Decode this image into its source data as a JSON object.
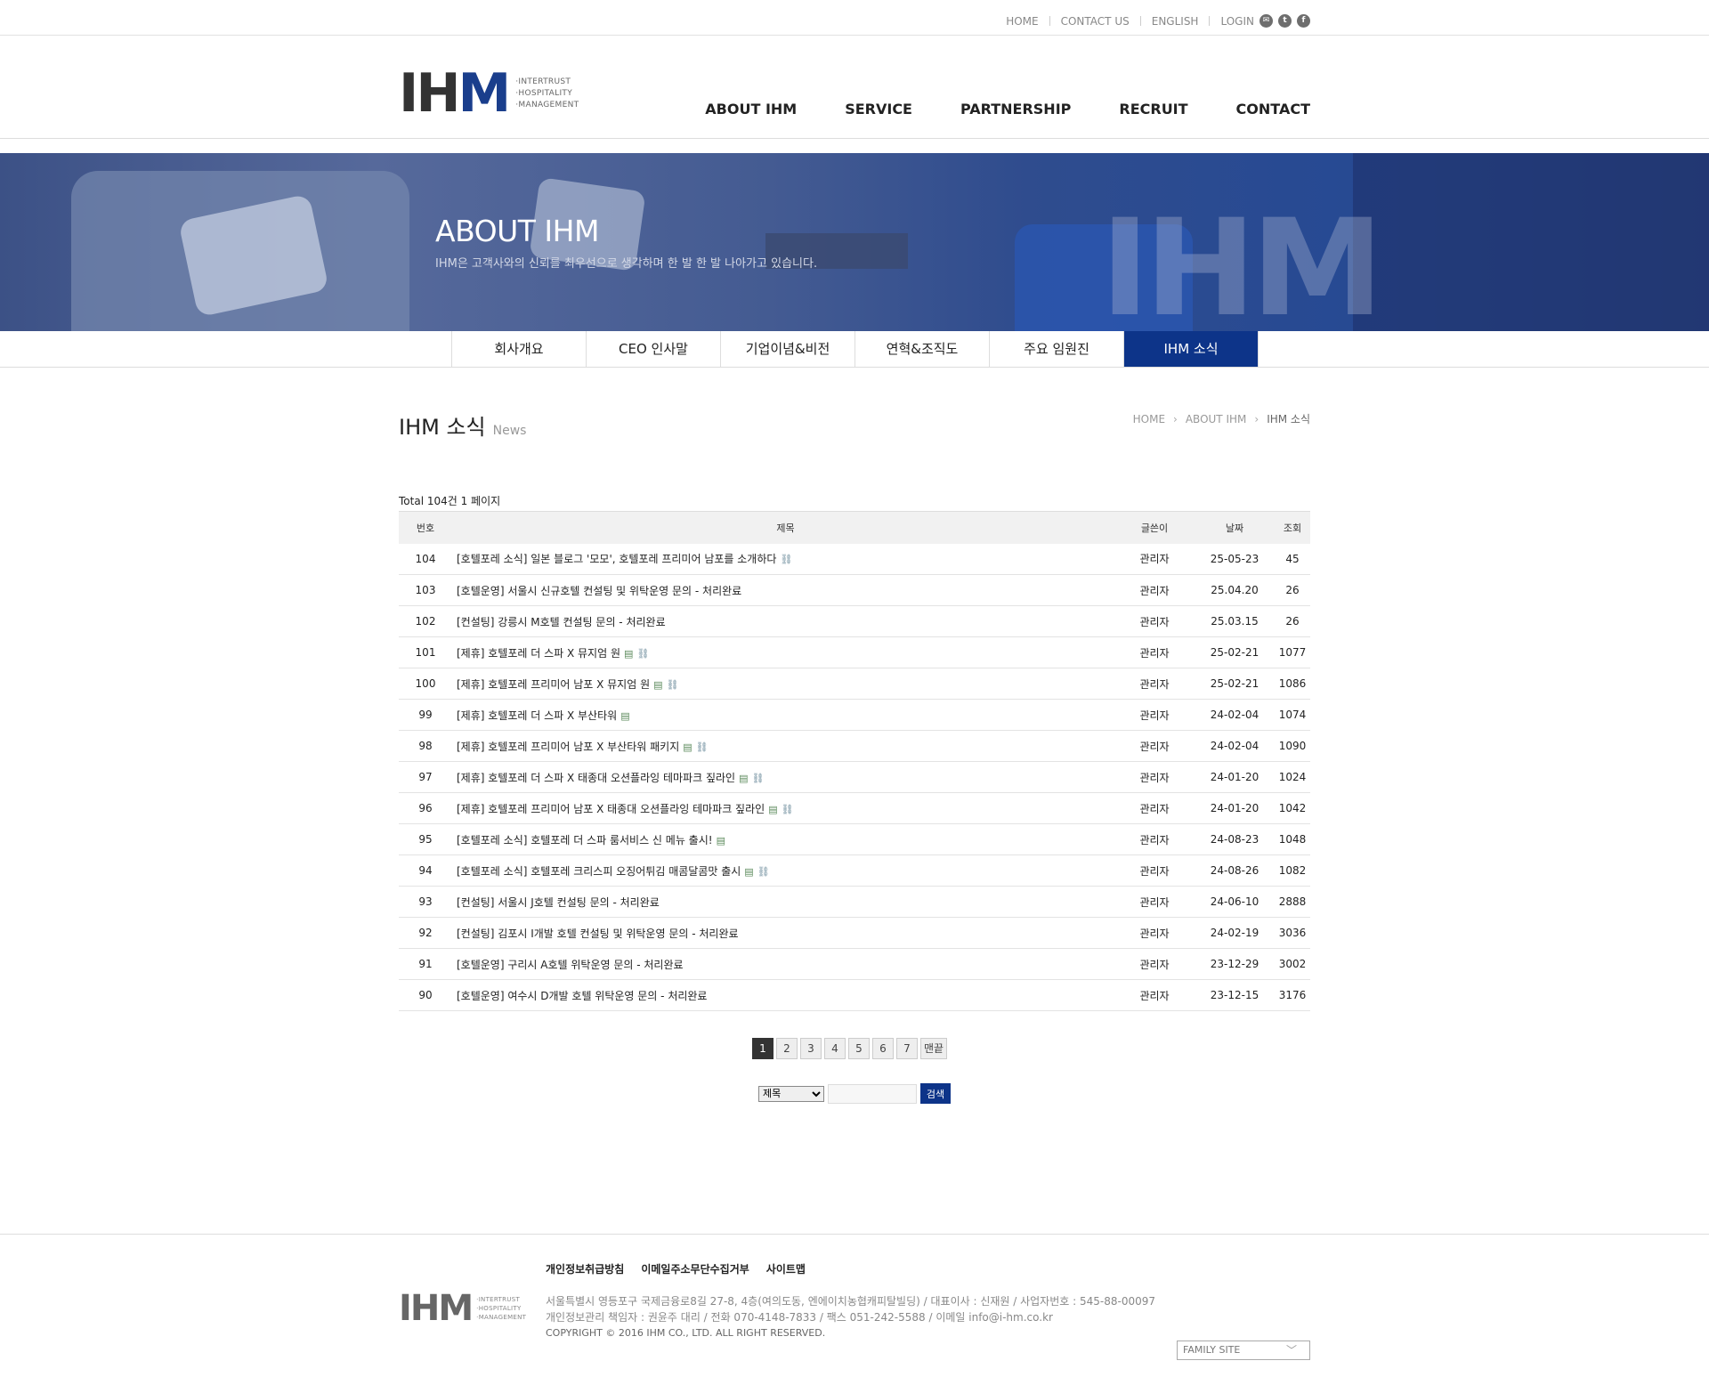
{
  "util_nav": {
    "home": "HOME",
    "contact_us": "CONTACT US",
    "english": "ENGLISH",
    "login": "LOGIN",
    "icons": [
      "mail-icon",
      "twitter-icon",
      "facebook-icon"
    ]
  },
  "logo": {
    "mark_ih": "IH",
    "mark_m": "M",
    "sub1": "·INTERTRUST",
    "sub2": "·HOSPITALITY",
    "sub3": "·MANAGEMENT"
  },
  "gnb": [
    "ABOUT IHM",
    "SERVICE",
    "PARTNERSHIP",
    "RECRUIT",
    "CONTACT"
  ],
  "hero": {
    "title": "ABOUT IHM",
    "subtitle": "IHM은 고객사와의 신뢰를 최우선으로 생각하며 한 발 한 발 나아가고 있습니다.",
    "watermark": "IHM"
  },
  "subnav": [
    "회사개요",
    "CEO 인사말",
    "기업이념&비전",
    "연혁&조직도",
    "주요 임원진",
    "IHM 소식"
  ],
  "page": {
    "title": "IHM 소식",
    "title_en": "News",
    "breadcrumb": [
      "HOME",
      "ABOUT IHM",
      "IHM 소식"
    ],
    "total": "Total 104건 1 페이지"
  },
  "board": {
    "headers": [
      "번호",
      "제목",
      "글쓴이",
      "날짜",
      "조회"
    ],
    "rows": [
      {
        "no": "104",
        "title": "[호텔포레 소식] 일본 블로그 '모모', 호텔포레 프리미어 남포를 소개하다",
        "file": false,
        "link": true,
        "writer": "관리자",
        "date": "25-05-23",
        "hit": "45"
      },
      {
        "no": "103",
        "title": "[호텔운영] 서울시 신규호텔 컨설팅 및 위탁운영 문의 - 처리완료",
        "file": false,
        "link": false,
        "writer": "관리자",
        "date": "25.04.20",
        "hit": "26"
      },
      {
        "no": "102",
        "title": "[컨설팅] 강릉시 M호텔 컨설팅 문의 - 처리완료",
        "file": false,
        "link": false,
        "writer": "관리자",
        "date": "25.03.15",
        "hit": "26"
      },
      {
        "no": "101",
        "title": "[제휴] 호텔포레 더 스파 X 뮤지엄 원",
        "file": true,
        "link": true,
        "writer": "관리자",
        "date": "25-02-21",
        "hit": "1077"
      },
      {
        "no": "100",
        "title": "[제휴] 호텔포레 프리미어 남포 X 뮤지엄 원",
        "file": true,
        "link": true,
        "writer": "관리자",
        "date": "25-02-21",
        "hit": "1086"
      },
      {
        "no": "99",
        "title": "[제휴] 호텔포레 더 스파 X 부산타워",
        "file": true,
        "link": false,
        "writer": "관리자",
        "date": "24-02-04",
        "hit": "1074"
      },
      {
        "no": "98",
        "title": "[제휴] 호텔포레 프리미어 남포 X 부산타워 패키지",
        "file": true,
        "link": true,
        "writer": "관리자",
        "date": "24-02-04",
        "hit": "1090"
      },
      {
        "no": "97",
        "title": "[제휴] 호텔포레 더 스파 X 태종대 오션플라잉 테마파크 짚라인",
        "file": true,
        "link": true,
        "writer": "관리자",
        "date": "24-01-20",
        "hit": "1024"
      },
      {
        "no": "96",
        "title": "[제휴] 호텔포레 프리미어 남포 X 태종대 오션플라잉 테마파크 짚라인",
        "file": true,
        "link": true,
        "writer": "관리자",
        "date": "24-01-20",
        "hit": "1042"
      },
      {
        "no": "95",
        "title": "[호텔포레 소식] 호텔포레 더 스파 룸서비스 신 메뉴 출시!",
        "file": true,
        "link": false,
        "writer": "관리자",
        "date": "24-08-23",
        "hit": "1048"
      },
      {
        "no": "94",
        "title": "[호텔포레 소식] 호텔포레 크리스피 오징어튀김 매콤달콤맛 출시",
        "file": true,
        "link": true,
        "writer": "관리자",
        "date": "24-08-26",
        "hit": "1082"
      },
      {
        "no": "93",
        "title": "[컨설팅] 서울시 J호텔 컨설팅 문의 - 처리완료",
        "file": false,
        "link": false,
        "writer": "관리자",
        "date": "24-06-10",
        "hit": "2888"
      },
      {
        "no": "92",
        "title": "[컨설팅] 김포시 I개발 호텔 컨설팅 및 위탁운영 문의 - 처리완료",
        "file": false,
        "link": false,
        "writer": "관리자",
        "date": "24-02-19",
        "hit": "3036"
      },
      {
        "no": "91",
        "title": "[호텔운영] 구리시 A호텔 위탁운영 문의 - 처리완료",
        "file": false,
        "link": false,
        "writer": "관리자",
        "date": "23-12-29",
        "hit": "3002"
      },
      {
        "no": "90",
        "title": "[호텔운영] 여수시 D개발 호텔 위탁운영 문의 - 처리완료",
        "file": false,
        "link": false,
        "writer": "관리자",
        "date": "23-12-15",
        "hit": "3176"
      }
    ]
  },
  "pager": {
    "pages": [
      "1",
      "2",
      "3",
      "4",
      "5",
      "6",
      "7"
    ],
    "current": "1",
    "last": "맨끝"
  },
  "search": {
    "select_value": "제목",
    "input_value": "",
    "button": "검색"
  },
  "footer": {
    "links": [
      "개인정보취급방침",
      "이메일주소무단수집거부",
      "사이트맵"
    ],
    "address": "서울특별시 영등포구 국제금융로8길 27-8, 4층(여의도동, 엔에이치농협캐피탈빌딩) / 대표이사 : 신재원 / 사업자번호 : 545-88-00097",
    "privacy": "개인정보관리 책임자 : 권윤주 대리 / 전화 070-4148-7833 / 팩스 051-242-5588 / 이메일 info@i-hm.co.kr",
    "copyright": "COPYRIGHT © 2016 IHM CO., LTD. ALL RIGHT RESERVED.",
    "family_site": "FAMILY SITE"
  }
}
